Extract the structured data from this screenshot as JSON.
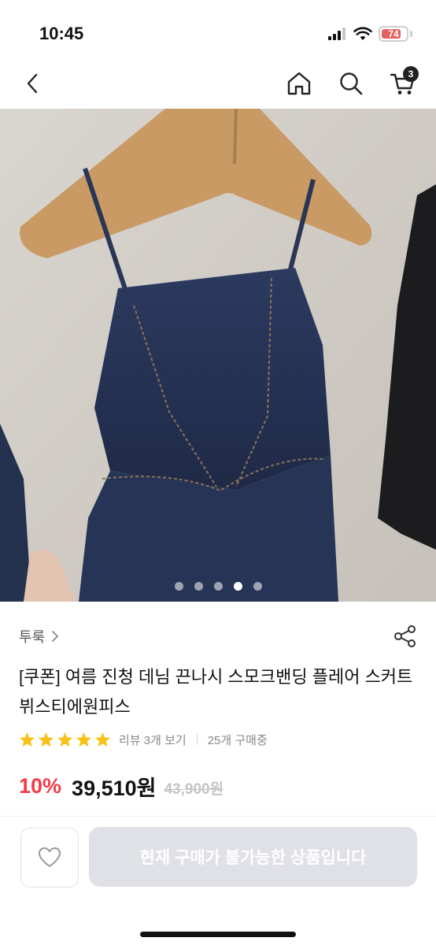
{
  "status": {
    "time": "10:45",
    "battery": "74"
  },
  "nav": {
    "cart_count": "3"
  },
  "gallery": {
    "slides": 5,
    "active_index": 3
  },
  "product": {
    "store": "투룩",
    "title": "[쿠폰] 여름 진청 데님 끈나시 스모크밴딩 플레어 스커트 뷔스티에원피스",
    "rating_stars": 5,
    "review_link": "리뷰 3개 보기",
    "buyers": "25개 구매중",
    "discount": "10%",
    "price": "39,510원",
    "original_price": "43,900원"
  },
  "actions": {
    "buy_label": "현재 구매가 불가능한 상품입니다"
  },
  "colors": {
    "accent_red": "#f43b47",
    "star_yellow": "#f7c21a",
    "disabled_button": "#dfe1e6"
  }
}
